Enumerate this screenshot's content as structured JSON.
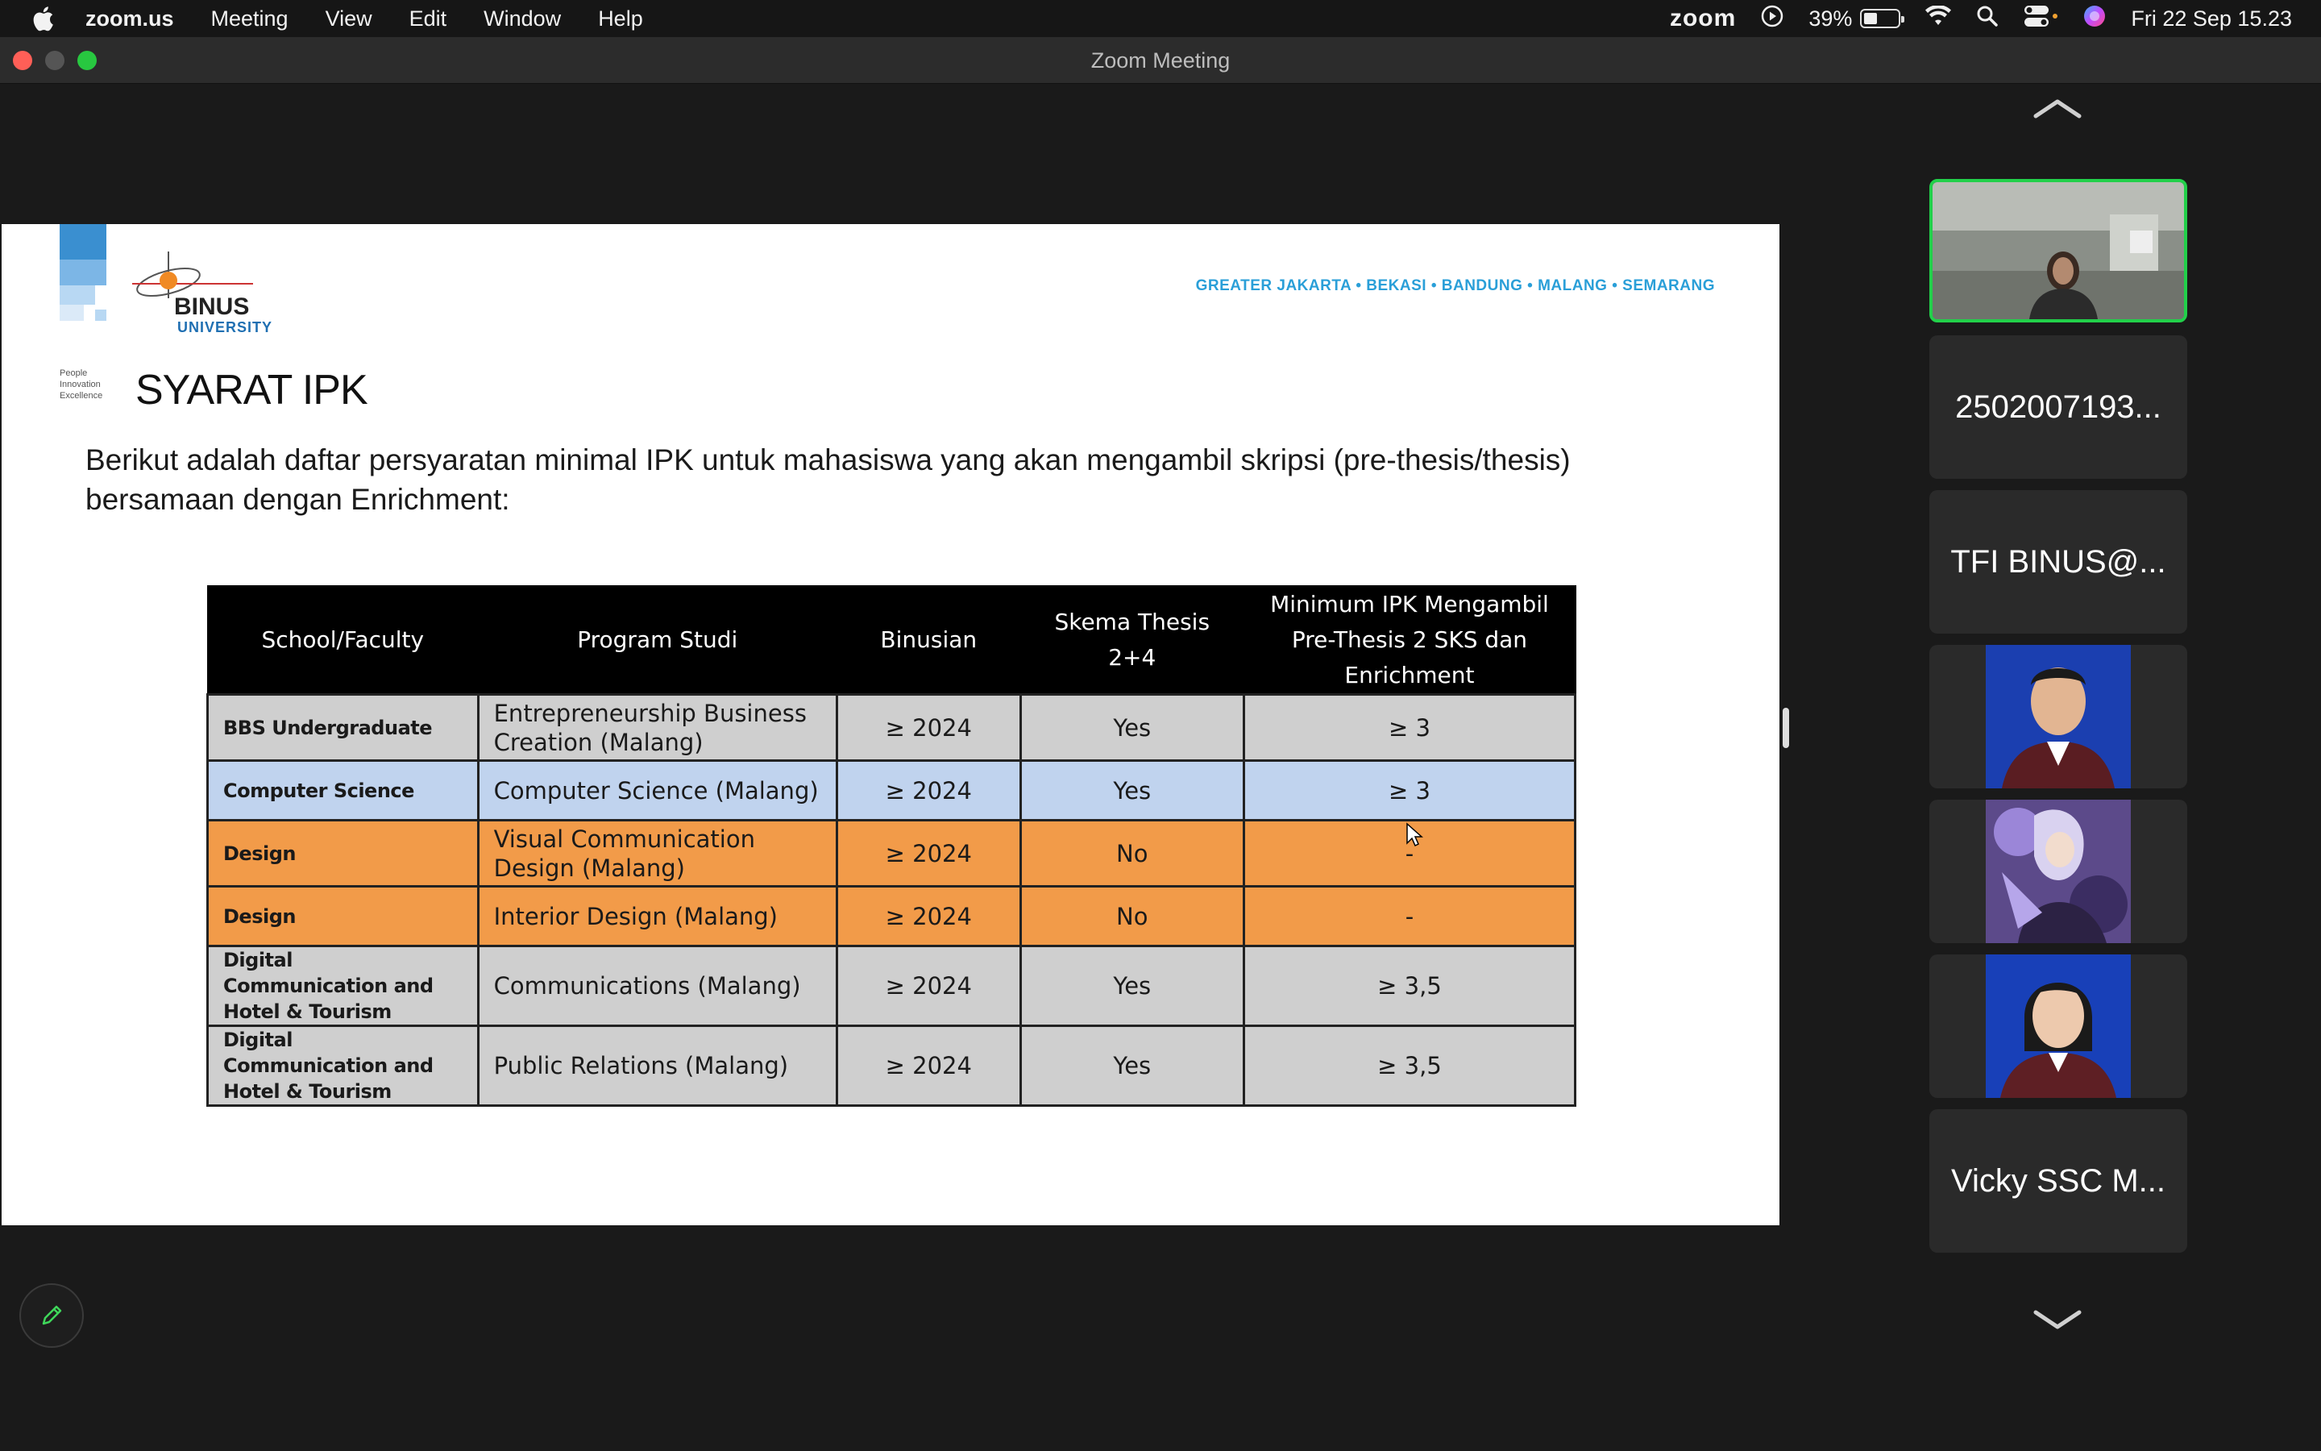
{
  "menubar": {
    "app": "zoom.us",
    "items": [
      "Meeting",
      "View",
      "Edit",
      "Window",
      "Help"
    ],
    "zoom_logo": "zoom",
    "battery_percent": "39%",
    "battery_level": 0.39,
    "datetime": "Fri 22 Sep  15.23"
  },
  "window": {
    "title": "Zoom Meeting"
  },
  "slide": {
    "logo_text": "BINUS",
    "logo_sub": "UNIVERSITY",
    "tagline": [
      "People",
      "Innovation",
      "Excellence"
    ],
    "cities": "GREATER JAKARTA • BEKASI • BANDUNG • MALANG • SEMARANG",
    "heading": "SYARAT IPK",
    "intro": "Berikut adalah daftar persyaratan minimal IPK untuk mahasiswa yang akan mengambil skripsi (pre-thesis/thesis) bersamaan dengan Enrichment:",
    "table": {
      "headers": [
        "School/Faculty",
        "Program Studi",
        "Binusian",
        "Skema Thesis 2+4",
        "Minimum IPK Mengambil Pre-Thesis 2 SKS dan Enrichment"
      ],
      "rows": [
        {
          "school": "BBS Undergraduate",
          "program": "Entrepreneurship Business Creation (Malang)",
          "binusian": "≥ 2024",
          "skema": "Yes",
          "ipk": "≥ 3",
          "color": "gray"
        },
        {
          "school": "Computer Science",
          "program": "Computer Science (Malang)",
          "binusian": "≥ 2024",
          "skema": "Yes",
          "ipk": "≥ 3",
          "color": "blue"
        },
        {
          "school": "Design",
          "program": "Visual Communication Design (Malang)",
          "binusian": "≥ 2024",
          "skema": "No",
          "ipk": "-",
          "color": "orange"
        },
        {
          "school": "Design",
          "program": "Interior Design (Malang)",
          "binusian": "≥ 2024",
          "skema": "No",
          "ipk": "-",
          "color": "orange"
        },
        {
          "school": "Digital Communication and Hotel & Tourism",
          "program": "Communications (Malang)",
          "binusian": "≥ 2024",
          "skema": "Yes",
          "ipk": "≥ 3,5",
          "color": "gray"
        },
        {
          "school": "Digital Communication and Hotel & Tourism",
          "program": "Public Relations (Malang)",
          "binusian": "≥ 2024",
          "skema": "Yes",
          "ipk": "≥ 3,5",
          "color": "gray"
        }
      ]
    }
  },
  "participants": [
    {
      "type": "video"
    },
    {
      "name": "2502007193..."
    },
    {
      "name": "TFI BINUS@..."
    },
    {
      "type": "photo"
    },
    {
      "type": "photo"
    },
    {
      "type": "photo"
    },
    {
      "name": "Vicky SSC M..."
    }
  ],
  "colors": {
    "active_speaker": "#22d04a",
    "row_gray": "#cfcfcf",
    "row_blue": "#c0d3ee",
    "row_orange": "#f29b49"
  }
}
